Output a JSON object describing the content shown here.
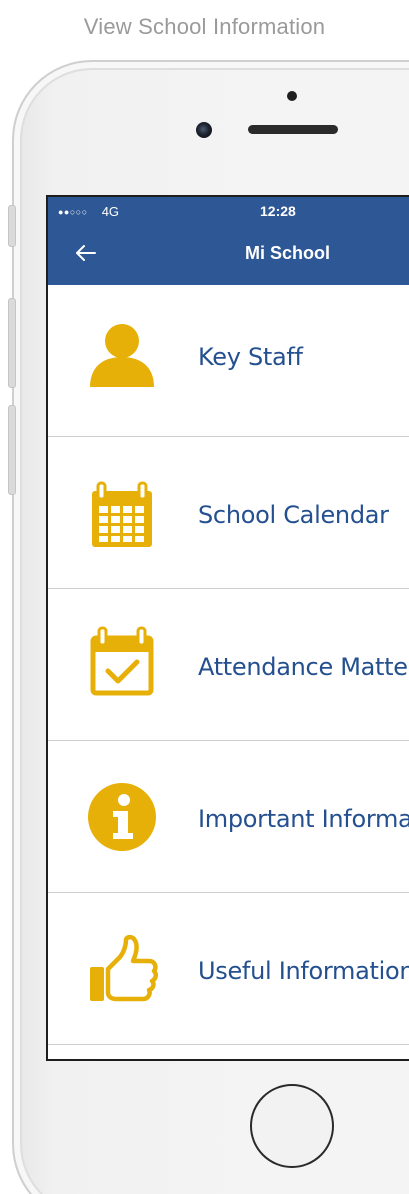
{
  "caption": "View School Information",
  "status_bar": {
    "signal": "●●○○○",
    "network": "4G",
    "time": "12:28"
  },
  "nav": {
    "back_icon": "arrow-left-icon",
    "title": "Mi School"
  },
  "menu": [
    {
      "label": "Key Staff",
      "icon": "person-icon"
    },
    {
      "label": "School Calendar",
      "icon": "calendar-icon"
    },
    {
      "label": "Attendance Matters",
      "icon": "calendar-check-icon"
    },
    {
      "label": "Important Information",
      "icon": "info-icon"
    },
    {
      "label": "Useful Information",
      "icon": "thumbs-up-icon"
    }
  ],
  "colors": {
    "header": "#2e5795",
    "accent_icon": "#e7b008",
    "label_text": "#24508f"
  }
}
